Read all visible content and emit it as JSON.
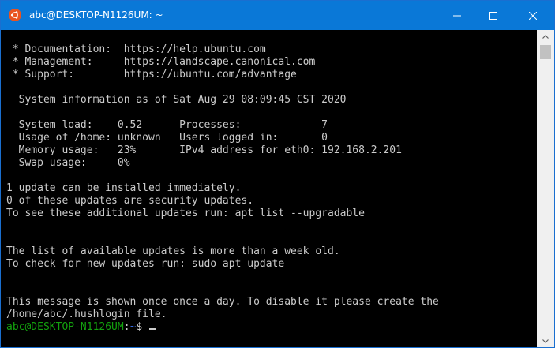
{
  "window": {
    "title": "abc@DESKTOP-N1126UM: ~",
    "app_icon": "ubuntu-icon",
    "controls": [
      "minimize-icon",
      "maximize-icon",
      "close-icon"
    ],
    "accent_color": "#0a78d7"
  },
  "terminal": {
    "lines": [
      " * Documentation:  https://help.ubuntu.com",
      " * Management:     https://landscape.canonical.com",
      " * Support:        https://ubuntu.com/advantage",
      "",
      "  System information as of Sat Aug 29 08:09:45 CST 2020",
      "",
      "  System load:    0.52      Processes:             7",
      "  Usage of /home: unknown   Users logged in:       0",
      "  Memory usage:   23%       IPv4 address for eth0: 192.168.2.201",
      "  Swap usage:     0%",
      "",
      "1 update can be installed immediately.",
      "0 of these updates are security updates.",
      "To see these additional updates run: apt list --upgradable",
      "",
      "",
      "The list of available updates is more than a week old.",
      "To check for new updates run: sudo apt update",
      "",
      "",
      "This message is shown once once a day. To disable it please create the",
      "/home/abc/.hushlogin file."
    ],
    "prompt": {
      "user_host": "abc@DESKTOP-N1126UM",
      "separator": ":",
      "path": "~",
      "symbol": "$ "
    },
    "colors": {
      "text": "#cccccc",
      "background": "#000000",
      "prompt_user": "#13a10e",
      "prompt_path": "#3b78ff"
    }
  }
}
